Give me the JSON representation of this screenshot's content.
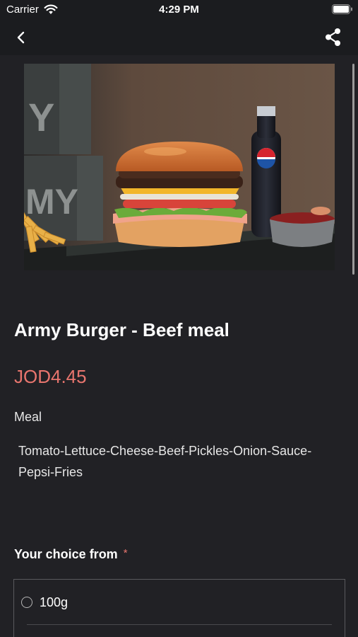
{
  "status_bar": {
    "carrier": "Carrier",
    "time": "4:29 PM"
  },
  "nav": {
    "back_icon": "chevron-left-icon",
    "share_icon": "share-icon"
  },
  "product": {
    "title": "Army Burger - Beef meal",
    "price": "JOD4.45",
    "category": "Meal",
    "description": "Tomato-Lettuce-Cheese-Beef-Pickles-Onion-Sauce-Pepsi-Fries"
  },
  "choices": {
    "header": "Your choice from",
    "required_mark": "*",
    "options": [
      {
        "label": "100g",
        "selected": false
      }
    ]
  },
  "colors": {
    "background": "#212125",
    "bar": "#1b1c1f",
    "price": "#e8756e",
    "text": "#ffffff"
  }
}
